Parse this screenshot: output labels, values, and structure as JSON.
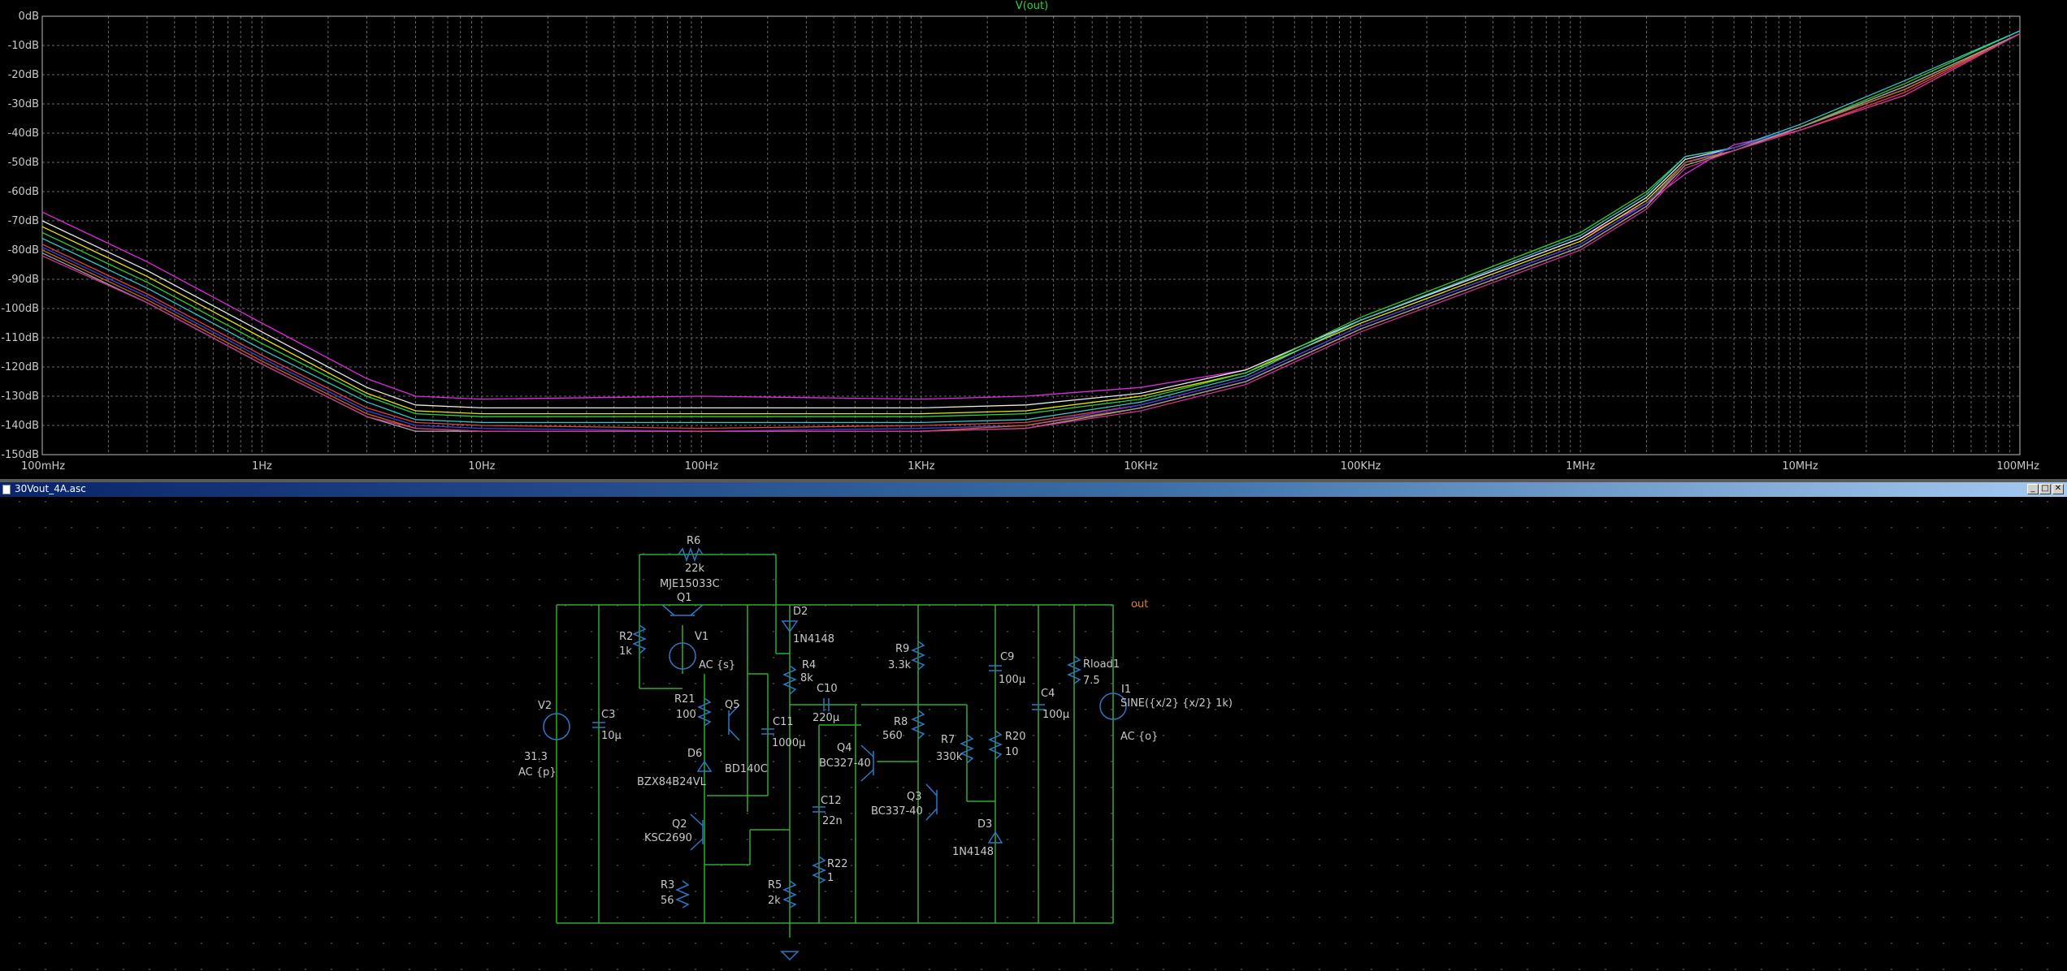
{
  "plot": {
    "title": "V(out)",
    "y_ticks": [
      "0dB",
      "-10dB",
      "-20dB",
      "-30dB",
      "-40dB",
      "-50dB",
      "-60dB",
      "-70dB",
      "-80dB",
      "-90dB",
      "-100dB",
      "-110dB",
      "-120dB",
      "-130dB",
      "-140dB",
      "-150dB"
    ],
    "x_ticks": [
      "100mHz",
      "1Hz",
      "10Hz",
      "100Hz",
      "1KHz",
      "10KHz",
      "100KHz",
      "1MHz",
      "10MHz",
      "100MHz"
    ]
  },
  "chart_data": {
    "type": "line",
    "title": "V(out)",
    "xlabel": "",
    "ylabel": "",
    "x_scale": "log",
    "xlim": [
      0.1,
      100000000
    ],
    "ylim": [
      -150,
      0
    ],
    "grid": true,
    "x": [
      0.1,
      0.3,
      1,
      3,
      5,
      10,
      100,
      1000,
      3000,
      10000,
      30000,
      100000,
      1000000,
      2000000,
      3000000,
      5000000,
      10000000,
      30000000,
      100000000
    ],
    "series": [
      {
        "color": "#e028e0",
        "values": [
          -67,
          -84,
          -105,
          -124,
          -130,
          -131,
          -130,
          -131,
          -130,
          -127,
          -121,
          -104,
          -76,
          -64,
          -54,
          -44,
          -39,
          -27,
          -6
        ]
      },
      {
        "color": "#e8e8e8",
        "values": [
          -70,
          -87,
          -108,
          -127,
          -133,
          -134,
          -134,
          -134,
          -133,
          -129,
          -121,
          -104,
          -76,
          -62,
          -49,
          -45,
          -38,
          -25,
          -6
        ]
      },
      {
        "color": "#e6e600",
        "values": [
          -72,
          -89,
          -110,
          -129,
          -135,
          -136,
          -136,
          -136,
          -135,
          -130,
          -122,
          -105,
          -77,
          -63,
          -50,
          -46,
          -38,
          -24,
          -6
        ]
      },
      {
        "color": "#30d030",
        "values": [
          -74,
          -91,
          -112,
          -130,
          -136,
          -137,
          -137,
          -137,
          -136,
          -131,
          -122,
          -103,
          -74,
          -60,
          -48,
          -45,
          -38,
          -23,
          -5
        ]
      },
      {
        "color": "#30c8c8",
        "values": [
          -76,
          -93,
          -114,
          -132,
          -138,
          -139,
          -139,
          -139,
          -138,
          -132,
          -123,
          -104,
          -75,
          -61,
          -48,
          -45,
          -37,
          -22,
          -5
        ]
      },
      {
        "color": "#e04040",
        "values": [
          -78,
          -95,
          -116,
          -134,
          -139,
          -140,
          -141,
          -140,
          -139,
          -133,
          -124,
          -106,
          -78,
          -64,
          -50,
          -45,
          -39,
          -26,
          -6
        ]
      },
      {
        "color": "#4040e0",
        "values": [
          -79,
          -96,
          -117,
          -135,
          -140,
          -141,
          -142,
          -141,
          -140,
          -133,
          -124,
          -106,
          -78,
          -64,
          -50,
          -45,
          -38,
          -24,
          -6
        ]
      },
      {
        "color": "#c86428",
        "values": [
          -80,
          -97,
          -118,
          -136,
          -141,
          -142,
          -142,
          -142,
          -140,
          -134,
          -125,
          -107,
          -79,
          -65,
          -50,
          -46,
          -38,
          -25,
          -6
        ]
      },
      {
        "color": "#a0a0a0",
        "values": [
          -81,
          -98,
          -119,
          -137,
          -142,
          -142,
          -142,
          -142,
          -141,
          -134,
          -125,
          -107,
          -79,
          -65,
          -51,
          -46,
          -38,
          -24,
          -6
        ]
      },
      {
        "color": "#d03090",
        "values": [
          -82,
          -98,
          -119,
          -137,
          -141,
          -142,
          -142,
          -142,
          -141,
          -135,
          -126,
          -108,
          -80,
          -66,
          -52,
          -46,
          -39,
          -27,
          -6
        ]
      }
    ]
  },
  "window": {
    "title": "30Vout_4A.asc",
    "minimize": "_",
    "restore": "□",
    "close": "✕"
  },
  "schematic": {
    "labels": {
      "R6": "R6",
      "R6v": "22k",
      "Q1p": "MJE15033C",
      "Q1": "Q1",
      "D2": "D2",
      "D2v": "1N4148",
      "out": "out",
      "R2": "R2",
      "R2v": "1k",
      "V1": "V1",
      "V1v": "AC {s}",
      "R4": "R4",
      "R4v": "8k",
      "R9": "R9",
      "R9v": "3.3k",
      "C9": "C9",
      "C9v": "100µ",
      "Rload": "Rload1",
      "Rloadv": "7.5",
      "I1": "I1",
      "I1v": "SINE({x/2} {x/2} 1k)",
      "I1ac": "AC {o}",
      "R21": "R21",
      "R21v": "100",
      "Q5": "Q5",
      "C10": "C10",
      "C10v": "220µ",
      "C4": "C4",
      "C4v": "100µ",
      "V2": "V2",
      "V2v": "31.3",
      "V2ac": "AC {p}",
      "C3": "C3",
      "C3v": "10µ",
      "C11": "C11",
      "C11v": "1000µ",
      "R8": "R8",
      "R8v": "560",
      "R20": "R20",
      "R20v": "10",
      "D6": "D6",
      "Q4": "Q4",
      "Q4v": "BC327-40",
      "R7": "R7",
      "R7v": "330k",
      "Q5v": "BD140C",
      "D6v": "BZX84B24VL",
      "Q3": "Q3",
      "Q3v": "BC337-40",
      "C12": "C12",
      "C12v": "22n",
      "D3": "D3",
      "D3v": "1N4148",
      "Q2": "Q2",
      "Q2v": "KSC2690",
      "R22": "R22",
      "R22v": "1",
      "R3": "R3",
      "R3v": "56",
      "R5": "R5",
      "R5v": "2k"
    }
  }
}
